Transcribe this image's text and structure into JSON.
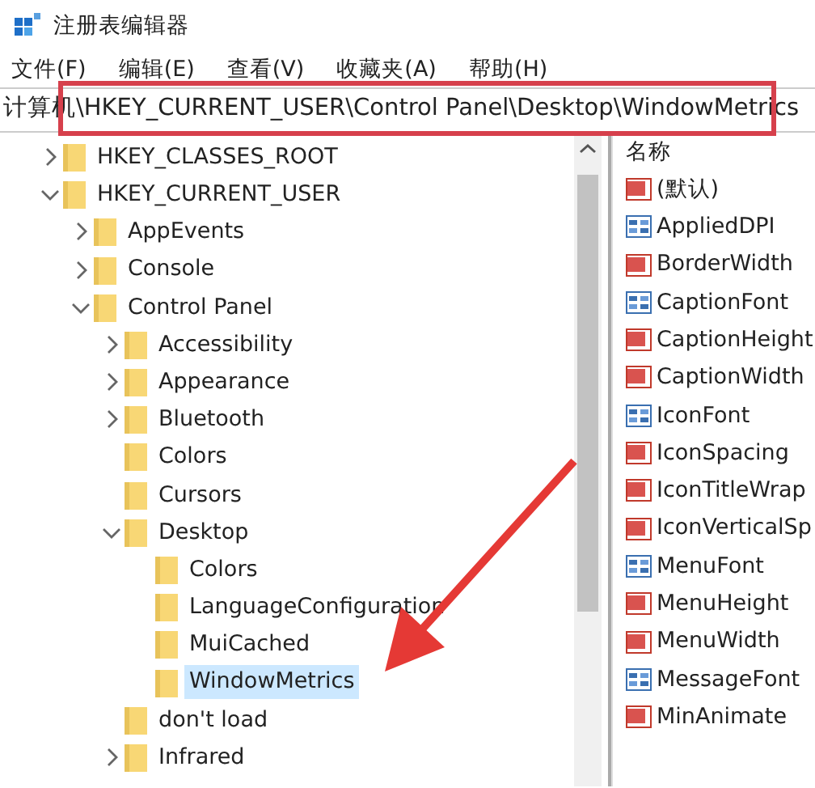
{
  "window": {
    "title": "注册表编辑器"
  },
  "menu": [
    "文件(F)",
    "编辑(E)",
    "查看(V)",
    "收藏夹(A)",
    "帮助(H)"
  ],
  "address": "计算机\\HKEY_CURRENT_USER\\Control Panel\\Desktop\\WindowMetrics",
  "tree": [
    {
      "label": "HKEY_CLASSES_ROOT",
      "expanded": false,
      "selected": false
    },
    {
      "label": "HKEY_CURRENT_USER",
      "expanded": true,
      "selected": false,
      "children": [
        {
          "label": "AppEvents",
          "expanded": false,
          "selected": false
        },
        {
          "label": "Console",
          "expanded": false,
          "selected": false
        },
        {
          "label": "Control Panel",
          "expanded": true,
          "selected": false,
          "children": [
            {
              "label": "Accessibility",
              "expanded": false,
              "selected": false
            },
            {
              "label": "Appearance",
              "expanded": false,
              "selected": false
            },
            {
              "label": "Bluetooth",
              "expanded": false,
              "selected": false
            },
            {
              "label": "Colors",
              "selected": false
            },
            {
              "label": "Cursors",
              "selected": false
            },
            {
              "label": "Desktop",
              "expanded": true,
              "selected": false,
              "children": [
                {
                  "label": "Colors",
                  "selected": false
                },
                {
                  "label": "LanguageConfiguration",
                  "selected": false
                },
                {
                  "label": "MuiCached",
                  "selected": false
                },
                {
                  "label": "WindowMetrics",
                  "selected": true
                }
              ]
            },
            {
              "label": "don't load",
              "selected": false
            },
            {
              "label": "Infrared",
              "expanded": false,
              "selected": false
            }
          ]
        }
      ]
    }
  ],
  "values_header": "名称",
  "values": [
    {
      "name": "(默认)",
      "kind": "string"
    },
    {
      "name": "AppliedDPI",
      "kind": "binary"
    },
    {
      "name": "BorderWidth",
      "kind": "string"
    },
    {
      "name": "CaptionFont",
      "kind": "binary"
    },
    {
      "name": "CaptionHeight",
      "kind": "string"
    },
    {
      "name": "CaptionWidth",
      "kind": "string"
    },
    {
      "name": "IconFont",
      "kind": "binary"
    },
    {
      "name": "IconSpacing",
      "kind": "string"
    },
    {
      "name": "IconTitleWrap",
      "kind": "string"
    },
    {
      "name": "IconVerticalSp",
      "kind": "string"
    },
    {
      "name": "MenuFont",
      "kind": "binary"
    },
    {
      "name": "MenuHeight",
      "kind": "string"
    },
    {
      "name": "MenuWidth",
      "kind": "string"
    },
    {
      "name": "MessageFont",
      "kind": "binary"
    },
    {
      "name": "MinAnimate",
      "kind": "string"
    }
  ]
}
